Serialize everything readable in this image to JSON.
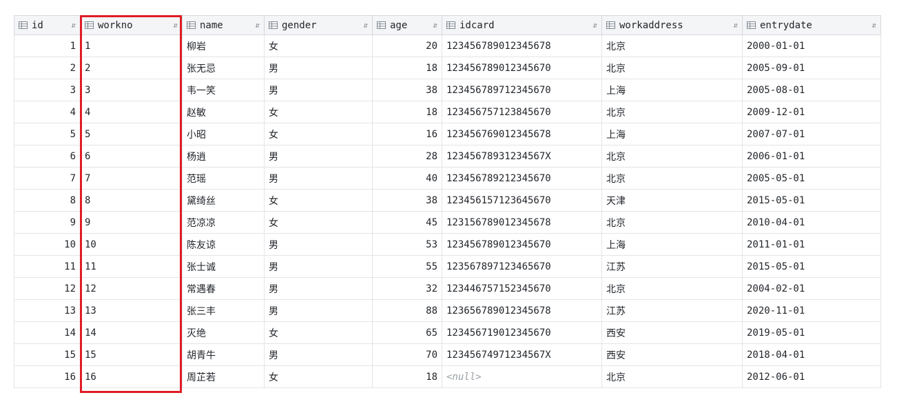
{
  "columns": [
    {
      "key": "id",
      "label": "id",
      "icon": "table-column-icon",
      "sort_icon": "sort-arrows-icon"
    },
    {
      "key": "workno",
      "label": "workno",
      "icon": "table-column-icon",
      "sort_icon": "sort-arrows-icon"
    },
    {
      "key": "name",
      "label": "name",
      "icon": "table-column-icon",
      "sort_icon": "sort-arrows-icon"
    },
    {
      "key": "gender",
      "label": "gender",
      "icon": "table-column-icon",
      "sort_icon": "sort-arrows-icon"
    },
    {
      "key": "age",
      "label": "age",
      "icon": "table-column-icon",
      "sort_icon": "sort-arrows-icon"
    },
    {
      "key": "idcard",
      "label": "idcard",
      "icon": "table-column-icon",
      "sort_icon": "sort-arrows-icon"
    },
    {
      "key": "workaddress",
      "label": "workaddress",
      "icon": "table-column-icon",
      "sort_icon": "sort-arrows-icon"
    },
    {
      "key": "entrydate",
      "label": "entrydate",
      "icon": "table-column-icon",
      "sort_icon": "sort-arrows-icon"
    }
  ],
  "rows": [
    {
      "id": "1",
      "workno": "1",
      "name": "柳岩",
      "gender": "女",
      "age": "20",
      "idcard": "123456789012345678",
      "workaddress": "北京",
      "entrydate": "2000-01-01"
    },
    {
      "id": "2",
      "workno": "2",
      "name": "张无忌",
      "gender": "男",
      "age": "18",
      "idcard": "123456789012345670",
      "workaddress": "北京",
      "entrydate": "2005-09-01"
    },
    {
      "id": "3",
      "workno": "3",
      "name": "韦一笑",
      "gender": "男",
      "age": "38",
      "idcard": "123456789712345670",
      "workaddress": "上海",
      "entrydate": "2005-08-01"
    },
    {
      "id": "4",
      "workno": "4",
      "name": "赵敏",
      "gender": "女",
      "age": "18",
      "idcard": "123456757123845670",
      "workaddress": "北京",
      "entrydate": "2009-12-01"
    },
    {
      "id": "5",
      "workno": "5",
      "name": "小昭",
      "gender": "女",
      "age": "16",
      "idcard": "123456769012345678",
      "workaddress": "上海",
      "entrydate": "2007-07-01"
    },
    {
      "id": "6",
      "workno": "6",
      "name": "杨逍",
      "gender": "男",
      "age": "28",
      "idcard": "12345678931234567X",
      "workaddress": "北京",
      "entrydate": "2006-01-01"
    },
    {
      "id": "7",
      "workno": "7",
      "name": "范瑶",
      "gender": "男",
      "age": "40",
      "idcard": "123456789212345670",
      "workaddress": "北京",
      "entrydate": "2005-05-01"
    },
    {
      "id": "8",
      "workno": "8",
      "name": "黛绮丝",
      "gender": "女",
      "age": "38",
      "idcard": "123456157123645670",
      "workaddress": "天津",
      "entrydate": "2015-05-01"
    },
    {
      "id": "9",
      "workno": "9",
      "name": "范凉凉",
      "gender": "女",
      "age": "45",
      "idcard": "123156789012345678",
      "workaddress": "北京",
      "entrydate": "2010-04-01"
    },
    {
      "id": "10",
      "workno": "10",
      "name": "陈友谅",
      "gender": "男",
      "age": "53",
      "idcard": "123456789012345670",
      "workaddress": "上海",
      "entrydate": "2011-01-01"
    },
    {
      "id": "11",
      "workno": "11",
      "name": "张士诚",
      "gender": "男",
      "age": "55",
      "idcard": "123567897123465670",
      "workaddress": "江苏",
      "entrydate": "2015-05-01"
    },
    {
      "id": "12",
      "workno": "12",
      "name": "常遇春",
      "gender": "男",
      "age": "32",
      "idcard": "123446757152345670",
      "workaddress": "北京",
      "entrydate": "2004-02-01"
    },
    {
      "id": "13",
      "workno": "13",
      "name": "张三丰",
      "gender": "男",
      "age": "88",
      "idcard": "123656789012345678",
      "workaddress": "江苏",
      "entrydate": "2020-11-01"
    },
    {
      "id": "14",
      "workno": "14",
      "name": "灭绝",
      "gender": "女",
      "age": "65",
      "idcard": "123456719012345670",
      "workaddress": "西安",
      "entrydate": "2019-05-01"
    },
    {
      "id": "15",
      "workno": "15",
      "name": "胡青牛",
      "gender": "男",
      "age": "70",
      "idcard": "12345674971234567X",
      "workaddress": "西安",
      "entrydate": "2018-04-01"
    },
    {
      "id": "16",
      "workno": "16",
      "name": "周芷若",
      "gender": "女",
      "age": "18",
      "idcard": "<null>",
      "workaddress": "北京",
      "entrydate": "2012-06-01"
    }
  ],
  "colors": {
    "highlight_border": "#e01b24",
    "header_bg": "#f4f5f7",
    "grid_line": "#e2e4e8",
    "null_text": "#9aa0a6"
  }
}
